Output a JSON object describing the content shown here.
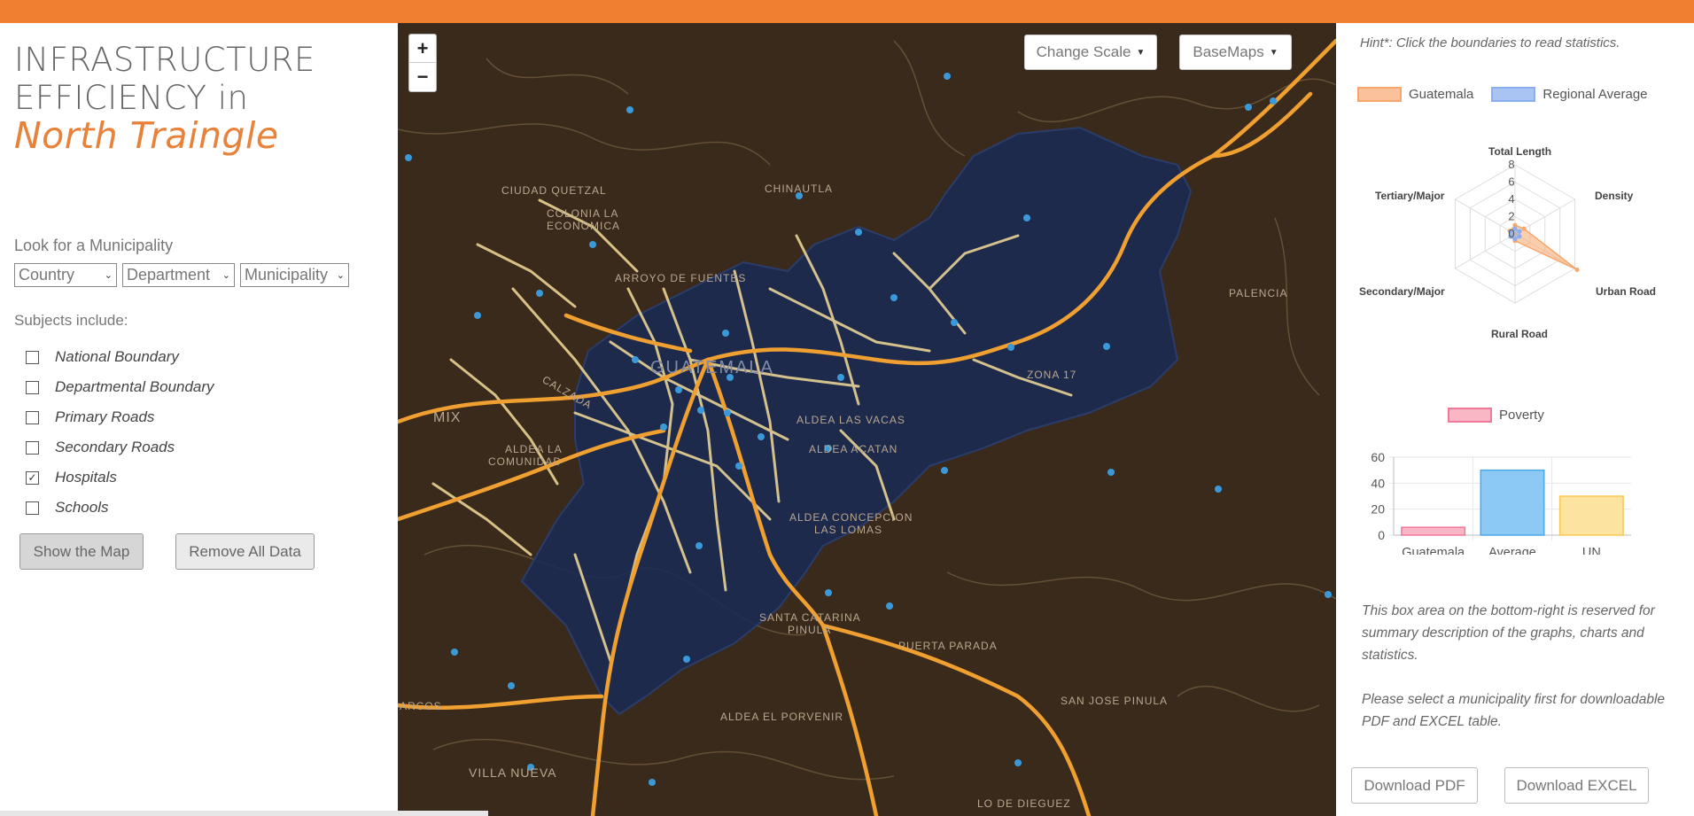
{
  "title": {
    "line1": "INFRASTRUCTURE",
    "line2_a": "EFFICIENCY ",
    "line2_b": "in",
    "line3": "North Traingle"
  },
  "search": {
    "label": "Look for a Municipality",
    "country": "Country",
    "department": "Department",
    "municipality": "Municipality"
  },
  "subjects": {
    "label": "Subjects include:",
    "items": [
      {
        "label": "National Boundary",
        "checked": false
      },
      {
        "label": "Departmental Boundary",
        "checked": false
      },
      {
        "label": "Primary Roads",
        "checked": false
      },
      {
        "label": "Secondary Roads",
        "checked": false
      },
      {
        "label": "Hospitals",
        "checked": true
      },
      {
        "label": "Schools",
        "checked": false
      }
    ]
  },
  "buttons": {
    "show_map": "Show the Map",
    "remove_all": "Remove All Data"
  },
  "map": {
    "zoom_in": "+",
    "zoom_out": "−",
    "change_scale": "Change Scale",
    "basemaps": "BaseMaps",
    "labels": {
      "ciudad_quetzal": "CIUDAD QUETZAL",
      "colonia_1": "COLONIA LA",
      "colonia_2": "ECONOMICA",
      "chinautla": "CHINAUTLA",
      "fuentes": "ARROYO DE FUENTES",
      "guatemala": "GUATEMALA",
      "vacas": "ALDEA LAS VACAS",
      "acatan": "ALDEA ACATAN",
      "concepcion_1": "ALDEA CONCEPCION",
      "concepcion_2": "LAS LOMAS",
      "santa_catarina_1": "SANTA CATARINA",
      "santa_catarina_2": "PINULA",
      "parada": "PUERTA PARADA",
      "porvenir": "ALDEA EL PORVENIR",
      "palencia": "PALENCIA",
      "zona": "ZONA 17",
      "comunidad_1": "ALDEA LA",
      "comunidad_2": "COMUNIDAD",
      "mixco": "MIX",
      "calzada": "CALZADA",
      "arcos": "ARCOS",
      "villa": "VILLA NUEVA",
      "pinula": "SAN JOSE PINULA",
      "dolores": "LO DE DIEGUEZ"
    },
    "colors": {
      "boundary_fill": "#1a2a52",
      "primary_road": "#f0a030",
      "secondary_road": "#f3dc9a",
      "hospital": "#3a9ad9"
    }
  },
  "right_panel": {
    "hint": "Hint*: Click the boundaries to read statistics.",
    "legend_country": "Guatemala",
    "legend_regional": "Regional Average",
    "poverty_legend": "Poverty",
    "summary_1": "This box area on the bottom-right is reserved for summary description of the graphs, charts and statistics.",
    "summary_2": "Please select a municipality first for downloadable PDF and EXCEL table.",
    "download_pdf": "Download PDF",
    "download_excel": "Download EXCEL"
  },
  "chart_data": [
    {
      "type": "radar",
      "axes": [
        "Total Length",
        "Density",
        "Urban Road",
        "Rural Road",
        "Secondary/Major",
        "Tertiary/Major"
      ],
      "ticks": [
        "0",
        "2",
        "4",
        "6",
        "8"
      ],
      "rmax": 8,
      "series": [
        {
          "name": "Guatemala",
          "values": [
            1,
            1.2,
            8.3,
            0.8,
            0.6,
            0.7
          ],
          "color": "#f7a76c"
        },
        {
          "name": "Regional Average",
          "values": [
            0.6,
            0.6,
            0.6,
            0.6,
            0.6,
            0.6
          ],
          "color": "#8aaef0"
        }
      ]
    },
    {
      "type": "bar",
      "categories": [
        "Guatemala",
        "Average",
        "UN"
      ],
      "series": [
        {
          "name": "Poverty",
          "values": [
            6,
            50,
            30
          ]
        }
      ],
      "bar_colors": [
        "#f9b7c6",
        "#8ccaf5",
        "#fde3a0"
      ],
      "border_colors": [
        "#f07898",
        "#48a8e8",
        "#f8c850"
      ],
      "yticks": [
        "0",
        "20",
        "40",
        "60"
      ],
      "ylim": [
        0,
        60
      ]
    }
  ]
}
